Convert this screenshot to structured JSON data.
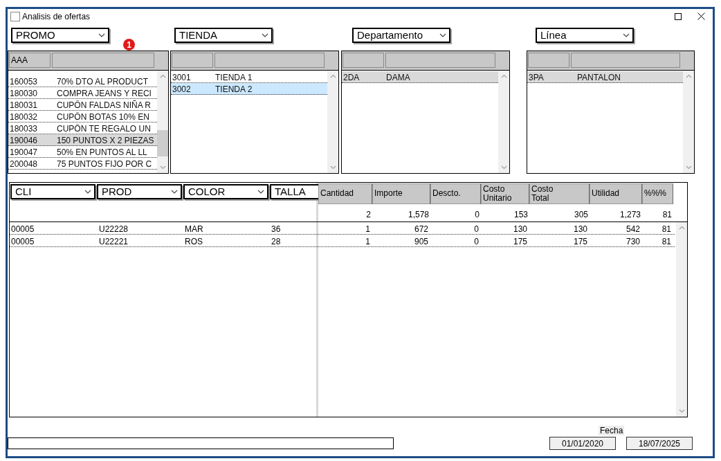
{
  "window": {
    "title": "Analisis de ofertas"
  },
  "filters": [
    {
      "label": "PROMO"
    },
    {
      "label": "TIENDA"
    },
    {
      "label": "Departamento"
    },
    {
      "label": "Línea"
    }
  ],
  "badge": "1",
  "lists": [
    {
      "header": "AAA",
      "focused": false,
      "rows": [
        {
          "code": "160053",
          "name": "70% DTO AL PRODUCT",
          "selected": false
        },
        {
          "code": "180030",
          "name": "COMPRA JEANS Y RECI",
          "selected": false
        },
        {
          "code": "180031",
          "name": "CUPÔN FALDAS NIÑA R",
          "selected": false
        },
        {
          "code": "180032",
          "name": "CUPÔN BOTAS 10% EN",
          "selected": false
        },
        {
          "code": "180033",
          "name": "CUPÔN TE REGALO UN",
          "selected": false
        },
        {
          "code": "190046",
          "name": "150 PUNTOS X 2 PIEZAS",
          "selected": true
        },
        {
          "code": "190047",
          "name": "50% EN PUNTOS AL LL",
          "selected": false
        },
        {
          "code": "200048",
          "name": "75 PUNTOS FIJO POR C",
          "selected": false
        }
      ]
    },
    {
      "focused": true,
      "rows": [
        {
          "code": "3001",
          "name": "TIENDA 1",
          "selected": false
        },
        {
          "code": "3002",
          "name": "TIENDA 2",
          "selected": true
        }
      ]
    },
    {
      "focused": false,
      "rows": [
        {
          "code": "2DA",
          "name": "DAMA",
          "selected": true
        }
      ]
    },
    {
      "focused": false,
      "rows": [
        {
          "code": "3PA",
          "name": "PANTALON",
          "selected": true
        }
      ]
    }
  ],
  "detail": {
    "filters": [
      "CLI",
      "PROD",
      "COLOR",
      "TALLA"
    ],
    "columns": [
      "Cantidad",
      "Importe",
      "Descto.",
      "Costo\nUnitario",
      "Costo\nTotal",
      "Utilidad",
      "%%%"
    ],
    "totals": [
      "2",
      "1,578",
      "0",
      "153",
      "305",
      "1,273",
      "81"
    ],
    "rows": [
      {
        "cells": [
          "00005",
          "U22228",
          "MAR",
          "36",
          "1",
          "672",
          "0",
          "130",
          "130",
          "542",
          "81"
        ]
      },
      {
        "cells": [
          "00005",
          "U22221",
          "ROS",
          "28",
          "1",
          "905",
          "0",
          "175",
          "175",
          "730",
          "81"
        ]
      }
    ]
  },
  "footer": {
    "date_label": "Fecha",
    "dates": [
      "01/01/2020",
      "18/07/2025"
    ]
  }
}
